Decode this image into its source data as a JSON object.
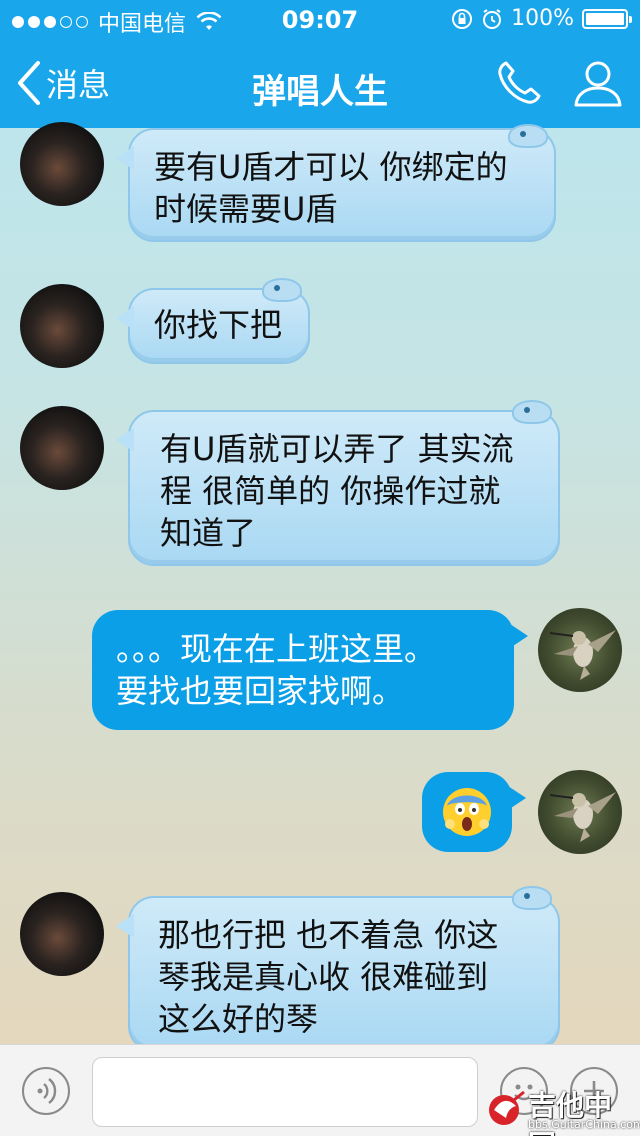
{
  "status_bar": {
    "carrier": "中国电信",
    "time": "09:07",
    "battery": "100%",
    "battery_level": 1.0,
    "signal_bars_filled": 3,
    "signal_bars_total": 5
  },
  "nav": {
    "back_label": "消息",
    "title": "弹唱人生",
    "icons": [
      "phone-icon",
      "profile-icon"
    ]
  },
  "messages": [
    {
      "sender": "friend",
      "lines": [
        "要有U盾才可以  你绑定的",
        "时候需要U盾"
      ]
    },
    {
      "sender": "friend",
      "lines": [
        "你找下把"
      ]
    },
    {
      "sender": "friend",
      "lines": [
        "有U盾就可以弄了 其实流",
        "程 很简单的 你操作过就",
        "知道了"
      ]
    },
    {
      "sender": "me",
      "lines": [
        "。。。现在在上班这里。",
        "要找也要回家找啊。"
      ]
    },
    {
      "sender": "me",
      "emoji": "scream-face"
    },
    {
      "sender": "friend",
      "lines": [
        "那也行把  也不着急  你这",
        "琴我是真心收  很难碰到",
        "这么好的琴"
      ]
    }
  ],
  "input_bar": {
    "placeholder": "",
    "icons": [
      "voice-icon",
      "emoji-icon",
      "plus-icon"
    ]
  },
  "watermark": {
    "title": "吉他中国",
    "subtitle": "bbs.GuitarChina.com"
  },
  "colors": {
    "accent": "#1aa6ea",
    "my_bubble": "#0b9fe8",
    "friend_bubble": "#b8e0f6"
  }
}
